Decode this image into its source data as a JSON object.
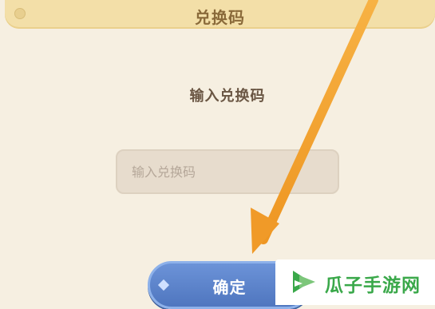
{
  "dialog": {
    "title": "兑换码",
    "prompt": "输入兑换码",
    "code_input": {
      "value": "",
      "placeholder": "输入兑换码"
    },
    "confirm_label": "确定"
  },
  "watermark": {
    "text": "瓜子手游网"
  },
  "colors": {
    "background": "#f6efe1",
    "title_bar": "#f3dfa8",
    "input_bg": "#e7dccd",
    "button": "#5b82cb",
    "arrow": "#f0a030",
    "watermark_green": "#3aa84a"
  },
  "icons": [
    "title-dot-icon",
    "arrow-annotation",
    "melon-leaf-logo-icon"
  ]
}
